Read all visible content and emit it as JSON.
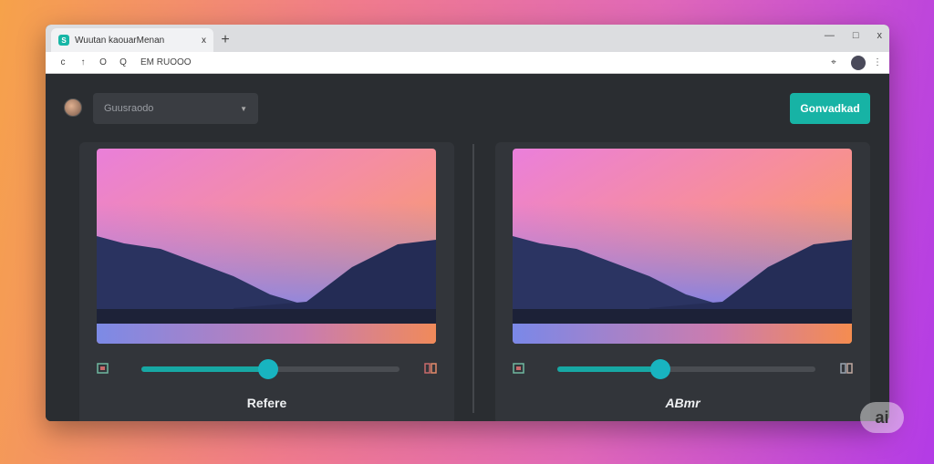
{
  "browser": {
    "tab_title": "Wuutan kaouarMenan",
    "tab_close": "x",
    "new_tab": "+",
    "win_minimize": "—",
    "win_maximize": "□",
    "win_close": "x",
    "nav_back": "c",
    "nav_forward": "↑",
    "nav_reload": "O",
    "nav_home": "Q",
    "url": "EM RUOOO",
    "ext_icon": "⌖",
    "menu": "⋮"
  },
  "toolbar": {
    "dropdown_label": "Guusraodo",
    "dropdown_caret": "▼",
    "primary_button": "Gonvadkad"
  },
  "panels": [
    {
      "caption": "Refere",
      "slider_value": 0.49
    },
    {
      "caption": "ABmr",
      "slider_value": 0.4
    }
  ],
  "badge": {
    "label": "ai"
  },
  "colors": {
    "accent": "#17b3a5",
    "window_bg": "#2a2d31",
    "panel_bg": "#32353a"
  },
  "icons": {
    "left_control": "image-icon",
    "right_control": "compare-icon"
  }
}
